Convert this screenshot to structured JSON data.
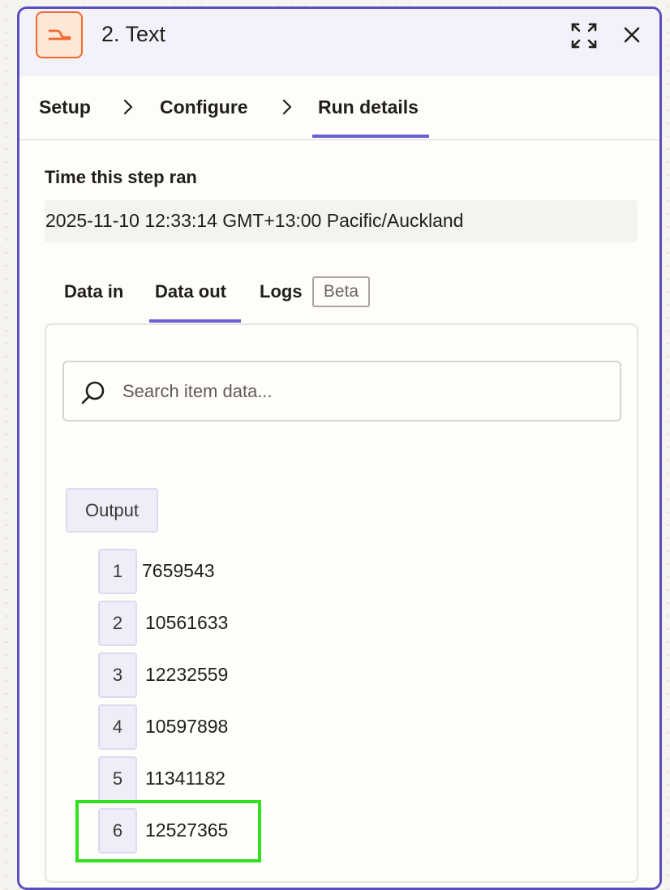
{
  "header": {
    "title": "2. Text",
    "app_icon": "text-formatter-icon",
    "accent_color": "#f16a30"
  },
  "steps": [
    {
      "label": "Setup"
    },
    {
      "label": "Configure"
    },
    {
      "label": "Run details",
      "active": true
    }
  ],
  "run": {
    "time_label": "Time this step ran",
    "time_value": "2025-11-10 12:33:14 GMT+13:00 Pacific/Auckland"
  },
  "subtabs": [
    {
      "label": "Data in"
    },
    {
      "label": "Data out",
      "active": true
    },
    {
      "label": "Logs"
    }
  ],
  "beta_badge": "Beta",
  "search": {
    "placeholder": "Search item data...",
    "value": ""
  },
  "output": {
    "label": "Output",
    "items": [
      {
        "index": "1",
        "value": "7659543"
      },
      {
        "index": "2",
        "value": "10561633"
      },
      {
        "index": "3",
        "value": "12232559"
      },
      {
        "index": "4",
        "value": "10597898"
      },
      {
        "index": "5",
        "value": "11341182"
      },
      {
        "index": "6",
        "value": "12527365",
        "highlighted": true
      }
    ]
  },
  "colors": {
    "panel_border": "#5a4fc0",
    "active_underline": "#6b5fd6",
    "highlight": "#32e01f"
  }
}
